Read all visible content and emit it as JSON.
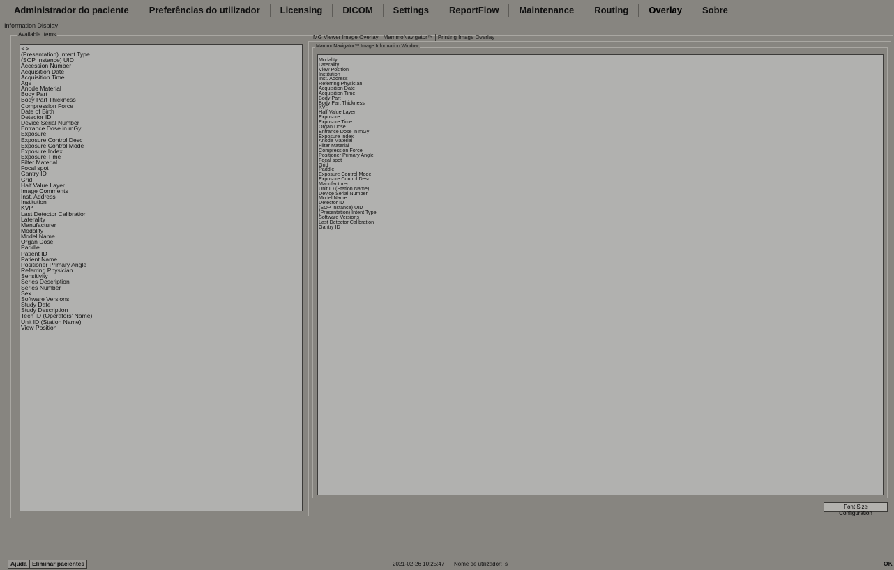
{
  "menu": [
    "Administrador do paciente",
    "Preferências do utilizador",
    "Licensing",
    "DICOM",
    "Settings",
    "ReportFlow",
    "Maintenance",
    "Routing",
    "Overlay",
    "Sobre"
  ],
  "section_title": "Information Display",
  "available": {
    "label": "Available Items",
    "items": [
      "< >",
      "(Presentation) Intent Type",
      "(SOP Instance) UID",
      "Accession Number",
      "Acquisition Date",
      "Acquisition Time",
      "Age",
      "Anode Material",
      "Body Part",
      "Body Part Thickness",
      "Compression Force",
      "Date of Birth",
      "Detector ID",
      "Device Serial Number",
      "Entrance Dose in mGy",
      "Exposure",
      "Exposure Control Desc",
      "Exposure Control Mode",
      "Exposure Index",
      "Exposure Time",
      "Filter Material",
      "Focal spot",
      "Gantry ID",
      "Grid",
      "Half Value Layer",
      "Image Comments",
      "Inst. Address",
      "Institution",
      "KVP",
      "Last Detector Calibration",
      "Laterality",
      "Manufacturer",
      "Modality",
      "Model Name",
      "Organ Dose",
      "Paddle",
      "Patient ID",
      "Patient Name",
      "Positioner Primary Angle",
      "Referring Physician",
      "Sensitivity",
      "Series Description",
      "Series Number",
      "Sex",
      "Software Versions",
      "Study Date",
      "Study Description",
      "Tech ID (Operators' Name)",
      "Unit ID (Station Name)",
      "View Position"
    ]
  },
  "tabs": [
    "MG Viewer Image Overlay",
    "MammoNavigator™",
    "Printing Image Overlay"
  ],
  "info_window": {
    "label": "MammoNavigator™ Image Information Window",
    "items": [
      "Modality",
      "Laterality",
      "View Position",
      "Institution",
      "Inst. Address",
      "Referring Physician",
      "Acquisition Date",
      "Acquisition Time",
      "Body Part",
      "Body Part Thickness",
      "KVP",
      "Half Value Layer",
      "Exposure",
      "Exposure Time",
      "Organ Dose",
      "Entrance Dose in mGy",
      "Exposure Index",
      "Anode Material",
      "Filter Material",
      "Compression Force",
      "Positioner Primary Angle",
      "Focal spot",
      "Grid",
      "Paddle",
      "Exposure Control Mode",
      "Exposure Control Desc",
      "Manufacturer",
      "Unit ID (Station Name)",
      "Device Serial Number",
      "Model Name",
      "Detector ID",
      "(SOP Instance) UID",
      "(Presentation) Intent Type",
      "Software Versions",
      "Last Detector Calibration",
      "Gantry ID"
    ]
  },
  "font_size_button": "Font Size Configuration",
  "status": {
    "help": "Ajuda",
    "delete_patients": "Eliminar pacientes",
    "datetime": "2021-02-26  10:25:47",
    "user_label": "Nome de utilizador:",
    "user": "s",
    "ok": "OK"
  }
}
